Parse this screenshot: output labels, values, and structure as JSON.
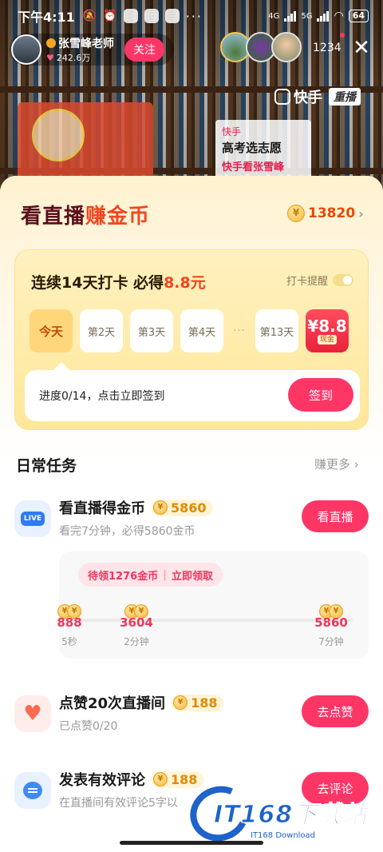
{
  "status_bar": {
    "time": "下午4:11",
    "net_1": "4G",
    "net_2": "5G",
    "battery": "64"
  },
  "live": {
    "host_name": "张雪峰老师",
    "host_likes": "242.6万",
    "follow_label": "关注",
    "viewer_count": "1234",
    "close_icon": "close-icon",
    "brand": "快手",
    "replay_label": "重播",
    "sign_line1": "快手",
    "sign_line2": "高考选志愿",
    "sign_line3": "快手看张雪峰"
  },
  "sheet": {
    "title_part1": "看直播",
    "title_part2": "赚金币",
    "coin_balance": "13820"
  },
  "checkin": {
    "title_prefix": "连续14天打卡 必得",
    "title_amount": "8.8元",
    "remind_label": "打卡提醒",
    "days": [
      "今天",
      "第2天",
      "第3天",
      "第4天",
      "···",
      "第13天"
    ],
    "prize_amount": "¥8.8",
    "prize_tag": "现金",
    "progress_text": "进度0/14，点击立即签到",
    "sign_label": "签到"
  },
  "daily": {
    "title": "日常任务",
    "earn_more": "赚更多",
    "tasks": [
      {
        "name": "看直播得金币",
        "reward": "5860",
        "desc": "看完7分钟，必得5860金币",
        "button": "看直播",
        "icon_label": "LIVE"
      },
      {
        "name": "点赞20次直播间",
        "reward": "188",
        "desc": "已点赞0/20",
        "button": "去点赞"
      },
      {
        "name": "发表有效评论",
        "reward": "188",
        "desc": "在直播间有效评论5字以",
        "button": "去评论"
      }
    ],
    "milestones": {
      "pending_label": "待领1276金币",
      "claim_label": "立即领取",
      "points": [
        {
          "value": "888",
          "label": "5秒"
        },
        {
          "value": "3604",
          "label": "2分钟"
        },
        {
          "value": "5860",
          "label": "7分钟"
        }
      ]
    }
  },
  "watermark": {
    "text": "IT168下载站",
    "sub": "IT168 Download"
  },
  "colors": {
    "accent": "#fe3666",
    "coin": "#f4b73a",
    "title_dark": "#5a0f1a",
    "title_red": "#f2451f"
  }
}
